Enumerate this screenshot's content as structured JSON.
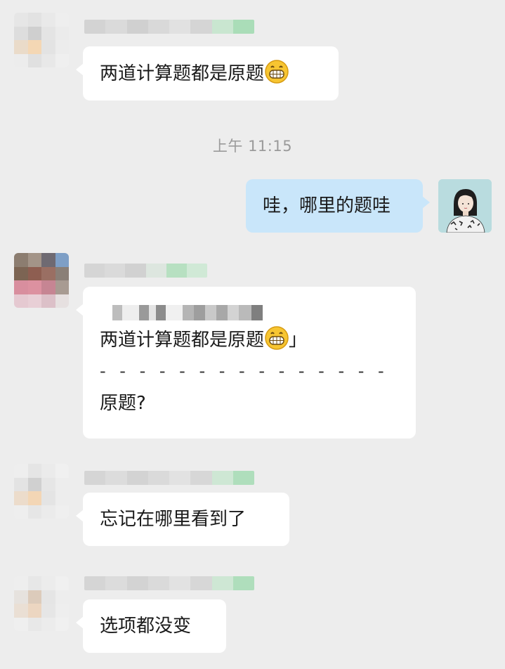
{
  "chat": {
    "timestamp": "上午 11:15",
    "messages": [
      {
        "id": "m1",
        "side": "left",
        "text": "两道计算题都是原题",
        "emoji": "grin-emoji"
      },
      {
        "id": "m2",
        "side": "right",
        "text": "哇，哪里的题哇"
      },
      {
        "id": "m3",
        "side": "left",
        "quote_text": "两道计算题都是原题",
        "quote_emoji": "grin-emoji",
        "quote_end": "」",
        "divider": "- - - - - - - - - - - - - - -",
        "text": "原题?"
      },
      {
        "id": "m4",
        "side": "left",
        "text": "忘记在哪里看到了"
      },
      {
        "id": "m5",
        "side": "left",
        "text": "选项都没变"
      }
    ]
  },
  "colors": {
    "background": "#ededed",
    "bubble_incoming": "#ffffff",
    "bubble_outgoing": "#c9e6fa",
    "timestamp": "#9a9a9a"
  }
}
